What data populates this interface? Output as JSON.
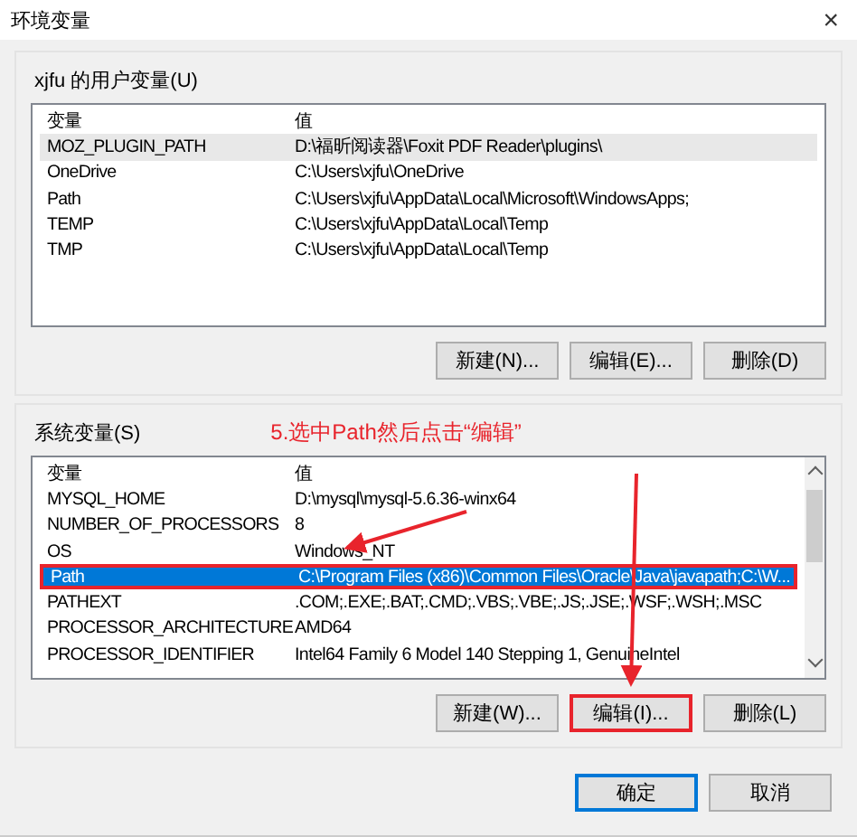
{
  "window": {
    "title": "环境变量",
    "close": "×"
  },
  "user_variables": {
    "label": "xjfu 的用户变量(U)",
    "focused": false,
    "columns": [
      "变量",
      "值"
    ],
    "rows": [
      {
        "name": "MOZ_PLUGIN_PATH",
        "value": "D:\\福昕阅读器\\Foxit PDF Reader\\plugins\\",
        "selected": true,
        "outlined": false
      },
      {
        "name": "OneDrive",
        "value": "C:\\Users\\xjfu\\OneDrive",
        "selected": false,
        "outlined": false
      },
      {
        "name": "Path",
        "value": "C:\\Users\\xjfu\\AppData\\Local\\Microsoft\\WindowsApps;",
        "selected": false,
        "outlined": false
      },
      {
        "name": "TEMP",
        "value": "C:\\Users\\xjfu\\AppData\\Local\\Temp",
        "selected": false,
        "outlined": false
      },
      {
        "name": "TMP",
        "value": "C:\\Users\\xjfu\\AppData\\Local\\Temp",
        "selected": false,
        "outlined": false
      }
    ],
    "buttons": [
      {
        "label": "新建(N)...",
        "outlined": false
      },
      {
        "label": "编辑(E)...",
        "outlined": false
      },
      {
        "label": "删除(D)",
        "outlined": false
      }
    ]
  },
  "annotation": {
    "text": "5.选中Path然后点击“编辑”"
  },
  "system_variables": {
    "label": "系统变量(S)",
    "focused": true,
    "columns": [
      "变量",
      "值"
    ],
    "rows": [
      {
        "name": "MYSQL_HOME",
        "value": "D:\\mysql\\mysql-5.6.36-winx64",
        "selected": false,
        "outlined": false
      },
      {
        "name": "NUMBER_OF_PROCESSORS",
        "value": "8",
        "selected": false,
        "outlined": false
      },
      {
        "name": "OS",
        "value": "Windows_NT",
        "selected": false,
        "outlined": false
      },
      {
        "name": "Path",
        "value": "C:\\Program Files (x86)\\Common Files\\Oracle\\Java\\javapath;C:\\W...",
        "selected": true,
        "outlined": true
      },
      {
        "name": "PATHEXT",
        "value": ".COM;.EXE;.BAT;.CMD;.VBS;.VBE;.JS;.JSE;.WSF;.WSH;.MSC",
        "selected": false,
        "outlined": false
      },
      {
        "name": "PROCESSOR_ARCHITECTURE",
        "value": "AMD64",
        "selected": false,
        "outlined": false
      },
      {
        "name": "PROCESSOR_IDENTIFIER",
        "value": "Intel64 Family 6 Model 140 Stepping 1, GenuineIntel",
        "selected": false,
        "outlined": false
      }
    ],
    "buttons": [
      {
        "label": "新建(W)...",
        "outlined": false
      },
      {
        "label": "编辑(I)...",
        "outlined": true
      },
      {
        "label": "删除(L)",
        "outlined": false
      }
    ]
  },
  "dialog_buttons": [
    {
      "label": "确定",
      "default": true
    },
    {
      "label": "取消",
      "default": false
    }
  ]
}
